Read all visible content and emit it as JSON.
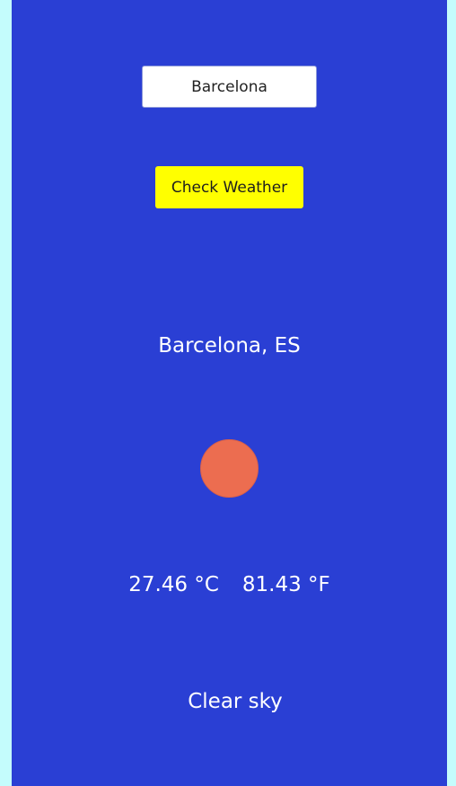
{
  "search": {
    "value": "Barcelona",
    "button_label": "Check Weather"
  },
  "weather": {
    "location": "Barcelona, ES",
    "icon": "sun-icon",
    "temp_c": "27.46 °C",
    "temp_f": "81.43 °F",
    "description": "Clear sky"
  },
  "colors": {
    "page_background": "#c4fcfc",
    "app_background": "#2a3fd4",
    "button_background": "#ffff00",
    "sun": "#ec6d50",
    "text": "#ffffff"
  }
}
